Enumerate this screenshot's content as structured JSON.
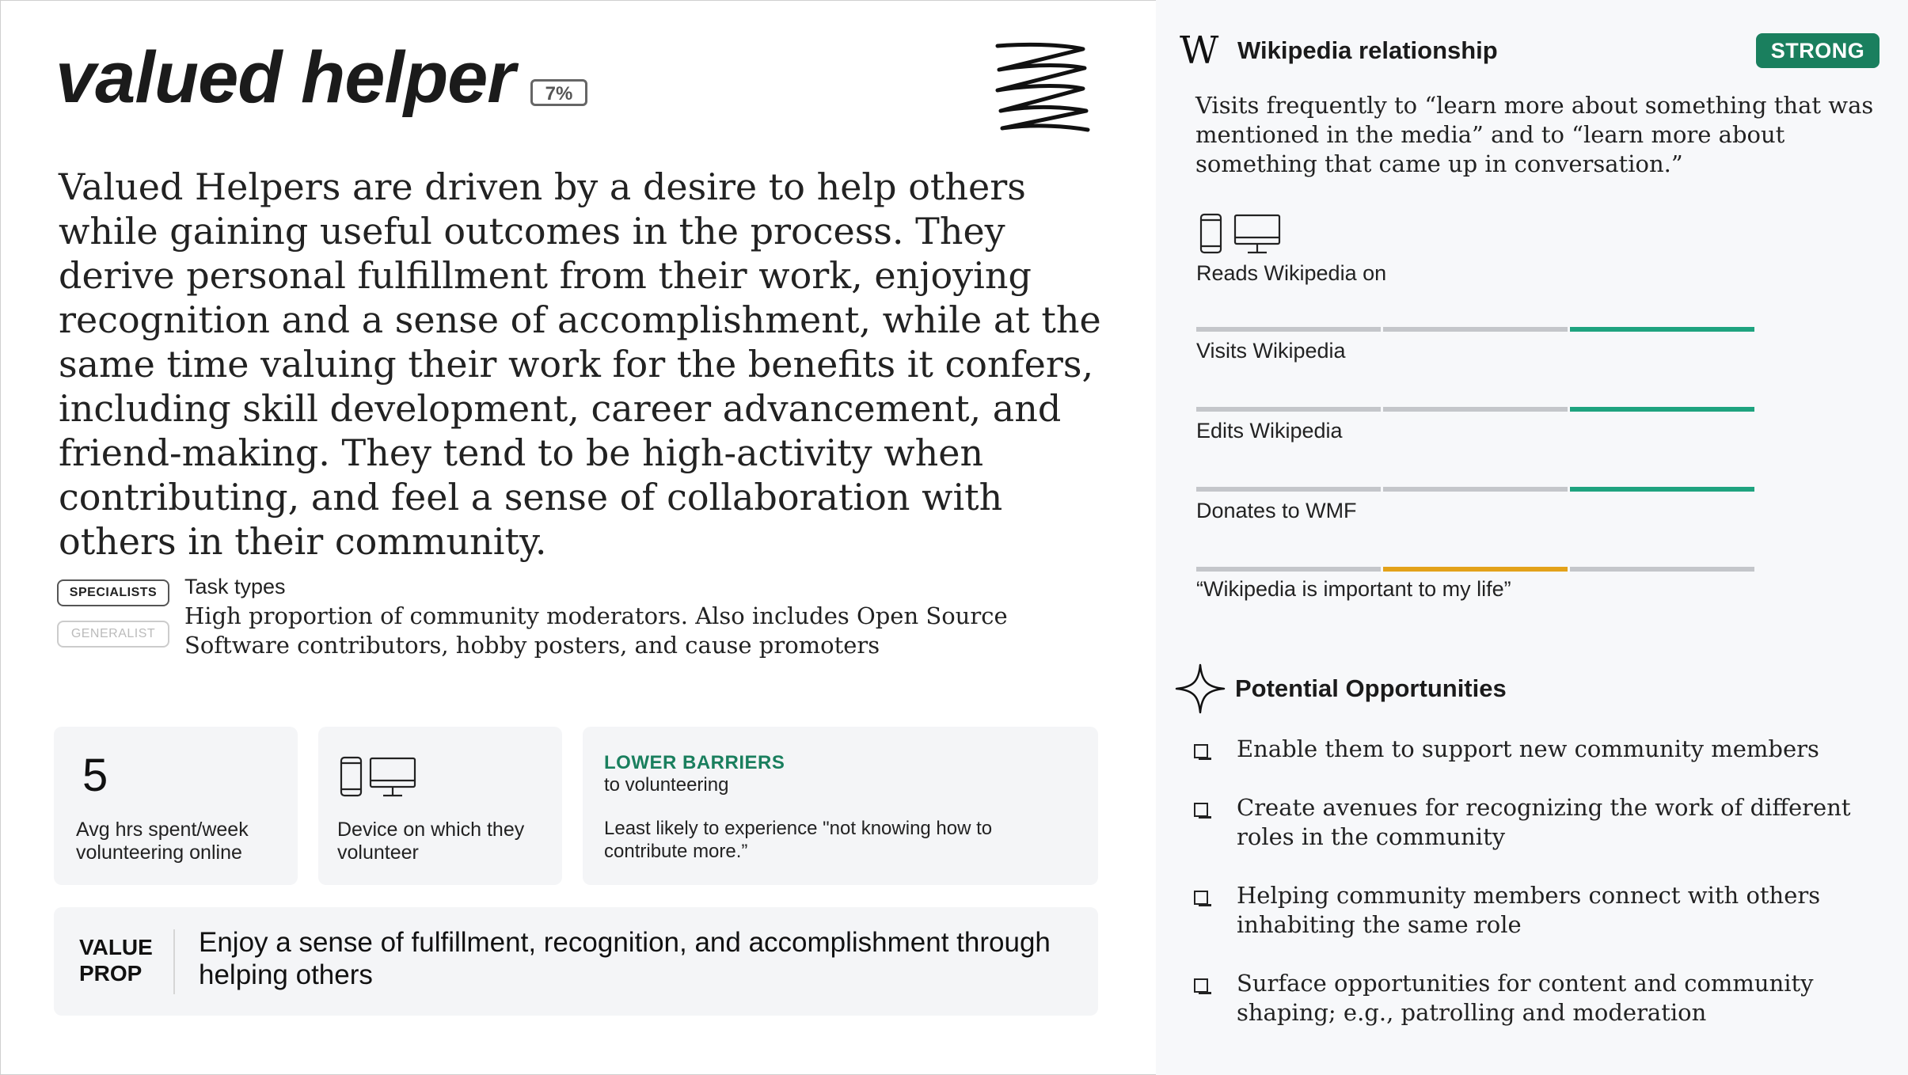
{
  "persona": {
    "title": "valued helper",
    "percent": "7%",
    "description": "Valued Helpers are driven by a desire to help others while gaining useful outcomes in the process. They derive personal fulfillment from their work, enjoying recognition and a sense of accomplishment, while at the same time valuing their work for the benefits it confers, including skill development, career advancement, and friend-making. They tend to be high-activity when contributing, and feel a sense of collaboration with others in their community."
  },
  "task_types": {
    "specialists_label": "SPECIALISTS",
    "generalist_label": "GENERALIST",
    "label": "Task types",
    "description": "High proportion of community moderators. Also includes Open Source Software contributors, hobby posters, and cause promoters"
  },
  "stats": {
    "hours_value": "5",
    "hours_label": "Avg hrs spent/week volunteering online",
    "device_label": "Device on which they volunteer",
    "device_icons": [
      "phone-icon",
      "desktop-icon"
    ],
    "barrier_title": "LOWER BARRIERS",
    "barrier_subtitle": "to volunteering",
    "barrier_description": "Least likely to experience \"not knowing how to contribute more.”"
  },
  "value_prop": {
    "label_line1": "VALUE",
    "label_line2": "PROP",
    "text": "Enjoy a sense of fulfillment, recognition, and accomplishment through helping others"
  },
  "relationship": {
    "logo": "W",
    "heading": "Wikipedia relationship",
    "badge": "STRONG",
    "quote": "Visits frequently to “learn more about something that was mentioned in the media” and to “learn more about something that came up in conversation.”",
    "reads_label": "Reads Wikipedia on",
    "reads_icons": [
      "phone-icon",
      "desktop-icon"
    ],
    "meters": [
      {
        "label": "Visits Wikipedia",
        "level": 3,
        "of": 3,
        "color": "#1fa37f"
      },
      {
        "label": "Edits Wikipedia",
        "level": 3,
        "of": 3,
        "color": "#1fa37f"
      },
      {
        "label": "Donates to WMF",
        "level": 3,
        "of": 3,
        "color": "#1fa37f"
      },
      {
        "label": "“Wikipedia is important to my life”",
        "level": 2,
        "of": 3,
        "color": "#e3a21a"
      }
    ]
  },
  "opportunities": {
    "heading": "Potential Opportunities",
    "items": [
      "Enable them to support new community members",
      "Create avenues for recognizing the work of different roles in the community",
      "Helping community members connect with others inhabiting the same role",
      "Surface opportunities for content and community shaping; e.g., patrolling and moderation"
    ]
  },
  "colors": {
    "accent_green": "#1a7f5e",
    "meter_green": "#1fa37f",
    "meter_yellow": "#e3a21a",
    "meter_track": "#c4c6ca",
    "panel_bg": "#f7f8fa"
  }
}
